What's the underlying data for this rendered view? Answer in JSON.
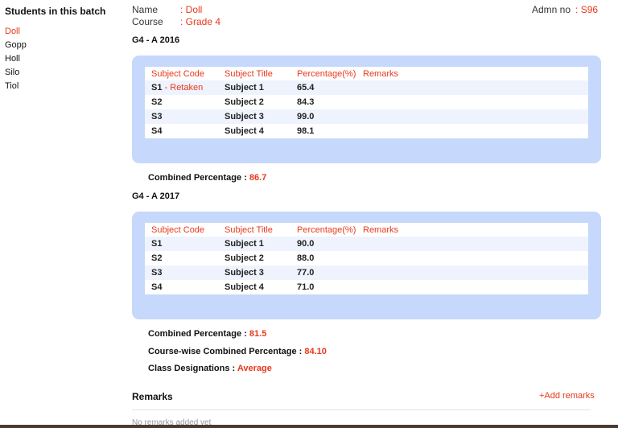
{
  "sidebar": {
    "title": "Students in this batch",
    "students": [
      "Doll",
      "Gopp",
      "Holl",
      "Silo",
      "Tiol"
    ],
    "active": "Doll"
  },
  "student": {
    "name_label": "Name",
    "name_value": ": Doll",
    "course_label": "Course",
    "course_value": ": Grade 4",
    "admn_label": "Admn no",
    "admn_value": ": S96"
  },
  "table_headers": {
    "code": "Subject Code",
    "title": "Subject Title",
    "percentage": "Percentage(%)",
    "remarks": "Remarks"
  },
  "batches": [
    {
      "title": "G4 - A 2016",
      "rows": [
        {
          "code": "S1",
          "retake": " - Retaken",
          "title": "Subject 1",
          "pct": "65.4",
          "remarks": ""
        },
        {
          "code": "S2",
          "retake": "",
          "title": "Subject 2",
          "pct": "84.3",
          "remarks": ""
        },
        {
          "code": "S3",
          "retake": "",
          "title": "Subject 3",
          "pct": "99.0",
          "remarks": ""
        },
        {
          "code": "S4",
          "retake": "",
          "title": "Subject 4",
          "pct": "98.1",
          "remarks": ""
        }
      ],
      "combined_label": "Combined Percentage : ",
      "combined_value": "86.7"
    },
    {
      "title": "G4 - A 2017",
      "rows": [
        {
          "code": "S1",
          "retake": "",
          "title": "Subject 1",
          "pct": "90.0",
          "remarks": ""
        },
        {
          "code": "S2",
          "retake": "",
          "title": "Subject 2",
          "pct": "88.0",
          "remarks": ""
        },
        {
          "code": "S3",
          "retake": "",
          "title": "Subject 3",
          "pct": "77.0",
          "remarks": ""
        },
        {
          "code": "S4",
          "retake": "",
          "title": "Subject 4",
          "pct": "71.0",
          "remarks": ""
        }
      ],
      "combined_label": "Combined Percentage : ",
      "combined_value": "81.5"
    }
  ],
  "course_wise": {
    "label": "Course-wise Combined Percentage : ",
    "value": "84.10"
  },
  "designation": {
    "label": "Class Designations : ",
    "value": "Average"
  },
  "remarks": {
    "title": "Remarks",
    "add_label": "+Add remarks",
    "empty_text": "No remarks added yet"
  },
  "colors": {
    "accent": "#e8391b",
    "panel": "#c6d8fb",
    "row_alt": "#eef3fd",
    "bottom_bar": "#4a3a33"
  }
}
